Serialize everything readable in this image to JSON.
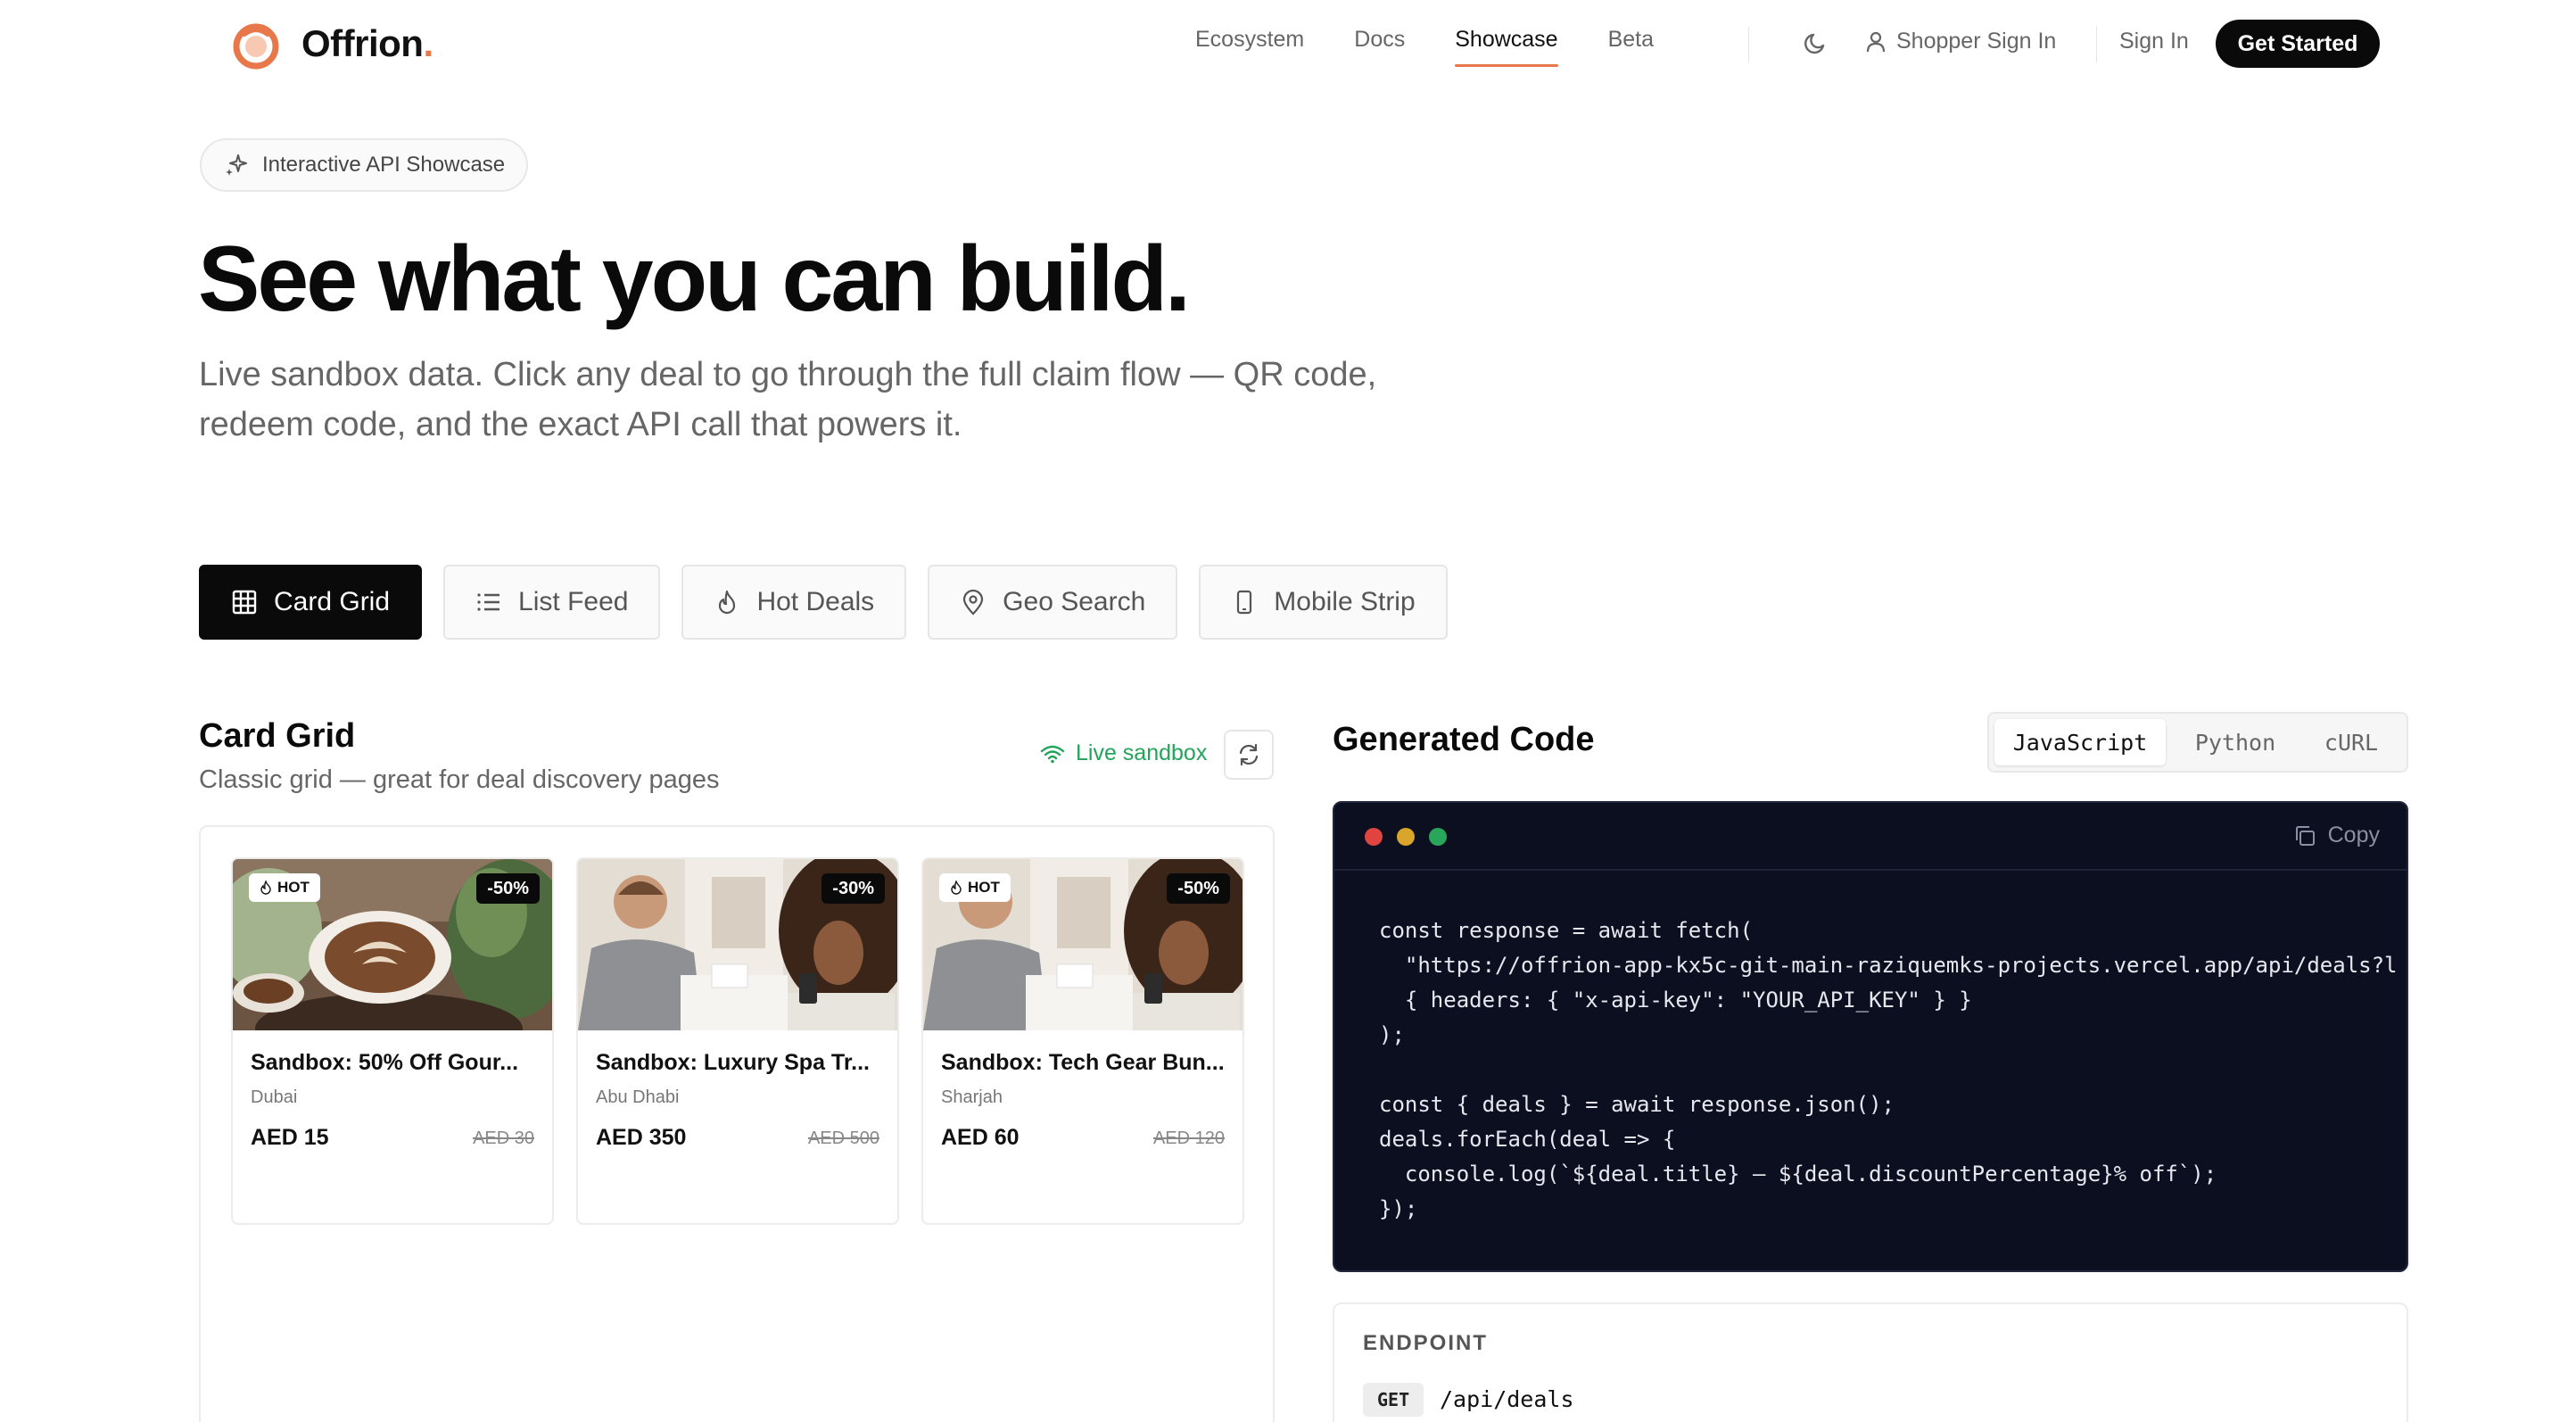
{
  "brand": {
    "name": "Offrion",
    "dot": ".",
    "accent": "#e8774a"
  },
  "nav": {
    "links": [
      "Ecosystem",
      "Docs",
      "Showcase",
      "Beta"
    ],
    "active": "Showcase",
    "shopper_sign_in": "Shopper Sign In",
    "sign_in": "Sign In",
    "get_started": "Get Started"
  },
  "hero": {
    "badge": "Interactive API Showcase",
    "title": "See what you can build.",
    "subtitle_line1": "Live sandbox data. Click any deal to go through the full claim flow — QR code,",
    "subtitle_line2": "redeem code, and the exact API call that powers it."
  },
  "tabs": [
    {
      "label": "Card Grid",
      "icon": "grid-icon",
      "active": true
    },
    {
      "label": "List Feed",
      "icon": "list-icon",
      "active": false
    },
    {
      "label": "Hot Deals",
      "icon": "flame-icon",
      "active": false
    },
    {
      "label": "Geo Search",
      "icon": "map-pin-icon",
      "active": false
    },
    {
      "label": "Mobile Strip",
      "icon": "mobile-icon",
      "active": false
    }
  ],
  "panel": {
    "title": "Card Grid",
    "subtitle": "Classic grid — great for deal discovery pages",
    "live_label": "Live sandbox",
    "live_color": "#22a45a"
  },
  "deals": [
    {
      "title": "Sandbox: 50% Off Gour...",
      "city": "Dubai",
      "price": "AED 15",
      "original": "AED 30",
      "discount": "-50%",
      "hot": "HOT",
      "image": "coffee-latte-image"
    },
    {
      "title": "Sandbox: Luxury Spa Tr...",
      "city": "Abu Dhabi",
      "price": "AED 350",
      "original": "AED 500",
      "discount": "-30%",
      "hot": "",
      "image": "store-checkout-image"
    },
    {
      "title": "Sandbox: Tech Gear Bun...",
      "city": "Sharjah",
      "price": "AED 60",
      "original": "AED 120",
      "discount": "-50%",
      "hot": "HOT",
      "image": "store-checkout-image"
    }
  ],
  "code": {
    "title": "Generated Code",
    "languages": [
      "JavaScript",
      "Python",
      "cURL"
    ],
    "active_language": "JavaScript",
    "copy_label": "Copy",
    "lines": [
      "const response = await fetch(",
      "  \"https://offrion-app-kx5c-git-main-raziquemks-projects.vercel.app/api/deals?l",
      "  { headers: { \"x-api-key\": \"YOUR_API_KEY\" } }",
      ");",
      "",
      "const { deals } = await response.json();",
      "deals.forEach(deal => {",
      "  console.log(`${deal.title} — ${deal.discountPercentage}% off`);",
      "});"
    ]
  },
  "endpoint": {
    "label": "ENDPOINT",
    "method": "GET",
    "path": "/api/deals"
  }
}
